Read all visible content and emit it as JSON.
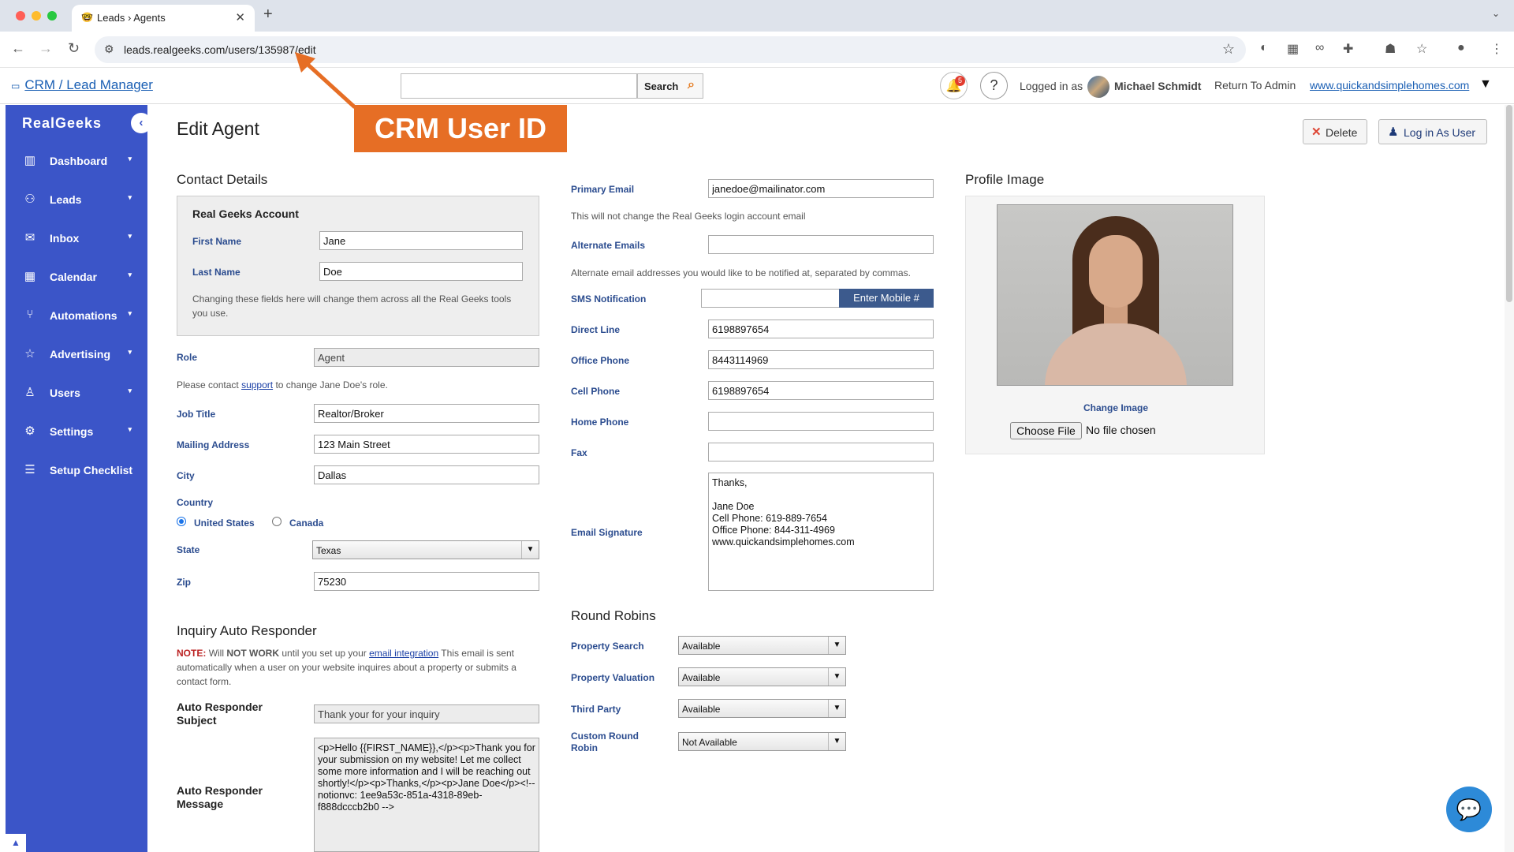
{
  "browser": {
    "tab_title": "Leads › Agents",
    "url": "leads.realgeeks.com/users/135987/edit",
    "colors": {
      "close": "#ff5f57",
      "minimize": "#febc2e",
      "maximize": "#28c840"
    }
  },
  "header": {
    "crm_link": "CRM / Lead Manager",
    "search_button": "Search",
    "notification_count": "5",
    "logged_in_as": "Logged in as",
    "user_name": "Michael Schmidt",
    "return_admin": "Return To Admin",
    "site_link": "www.quickandsimplehomes.com"
  },
  "sidebar": {
    "brand": "RealGeeks",
    "items": [
      {
        "label": "Dashboard",
        "icon": "chart-icon"
      },
      {
        "label": "Leads",
        "icon": "people-icon"
      },
      {
        "label": "Inbox",
        "icon": "envelope-icon"
      },
      {
        "label": "Calendar",
        "icon": "calendar-icon"
      },
      {
        "label": "Automations",
        "icon": "automation-icon"
      },
      {
        "label": "Advertising",
        "icon": "star-icon"
      },
      {
        "label": "Users",
        "icon": "user-icon"
      },
      {
        "label": "Settings",
        "icon": "gear-icon"
      },
      {
        "label": "Setup Checklist",
        "icon": "checklist-icon"
      }
    ],
    "accent": "#3b55c8"
  },
  "page": {
    "title": "Edit Agent",
    "callout": "CRM User ID",
    "callout_color": "#e66e25",
    "delete_button": "Delete",
    "login_as_button": "Log in As User"
  },
  "contact": {
    "heading": "Contact Details",
    "account_heading": "Real Geeks Account",
    "first_name_label": "First Name",
    "first_name": "Jane",
    "last_name_label": "Last Name",
    "last_name": "Doe",
    "account_note": "Changing these fields here will change them across all the Real Geeks tools you use.",
    "role_label": "Role",
    "role": "Agent",
    "role_note_pre": "Please contact",
    "role_note_link": "support",
    "role_note_post": "to change Jane Doe's role.",
    "job_title_label": "Job Title",
    "job_title": "Realtor/Broker",
    "mailing_label": "Mailing Address",
    "mailing": "123 Main Street",
    "city_label": "City",
    "city": "Dallas",
    "country_label": "Country",
    "country_us": "United States",
    "country_ca": "Canada",
    "state_label": "State",
    "state": "Texas",
    "zip_label": "Zip",
    "zip": "75230"
  },
  "responder": {
    "heading": "Inquiry Auto Responder",
    "note_strong": "NOTE:",
    "note_pre": "Will",
    "note_bold": "NOT WORK",
    "note_mid": "until you set up your",
    "note_link": "email integration",
    "note_post": "This email is sent automatically when a user on your website inquires about a property or submits a contact form.",
    "subject_label": "Auto Responder Subject",
    "subject": "Thank your for your inquiry",
    "message_label": "Auto Responder Message",
    "message": "<p>Hello {{FIRST_NAME}},</p><p>Thank you for your submission on my website! Let me collect some more information and I will be reaching out shortly!</p><p>Thanks,</p><p>Jane Doe</p><!-- notionvc: 1ee9a53c-851a-4318-89eb-f888dcccb2b0 -->"
  },
  "emails": {
    "primary_label": "Primary Email",
    "primary": "janedoe@mailinator.com",
    "primary_note": "This will not change the Real Geeks login account email",
    "alternate_label": "Alternate Emails",
    "alternate": "",
    "alternate_note": "Alternate email addresses you would like to be notified at, separated by commas.",
    "sms_label": "SMS Notification",
    "sms_button": "Enter Mobile #",
    "direct_label": "Direct Line",
    "direct": "6198897654",
    "office_label": "Office Phone",
    "office": "8443114969",
    "cell_label": "Cell Phone",
    "cell": "6198897654",
    "home_label": "Home Phone",
    "home": "",
    "fax_label": "Fax",
    "fax": "",
    "signature_label": "Email Signature",
    "signature": "Thanks,\n\nJane Doe\nCell Phone: 619-889-7654\nOffice Phone: 844-311-4969\nwww.quickandsimplehomes.com"
  },
  "round_robins": {
    "heading": "Round Robins",
    "items": [
      {
        "label": "Property Search",
        "value": "Available"
      },
      {
        "label": "Property Valuation",
        "value": "Available"
      },
      {
        "label": "Third Party",
        "value": "Available"
      },
      {
        "label": "Custom Round Robin",
        "value": "Not Available"
      }
    ]
  },
  "profile": {
    "heading": "Profile Image",
    "change_image": "Change Image",
    "choose_file": "Choose File",
    "no_file": "No file chosen"
  }
}
